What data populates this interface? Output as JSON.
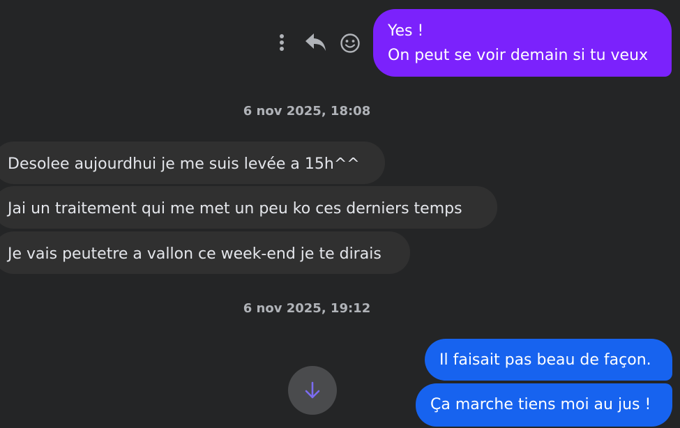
{
  "messages": [
    {
      "direction": "outgoing",
      "lines": [
        "Yes !",
        "On peut se voir demain si tu veux"
      ],
      "color": "#7b22fc"
    },
    {
      "timestamp": "6 nov 2025, 18:08"
    },
    {
      "direction": "incoming",
      "text": "Desolee aujourdhui je me suis levée a 15h^^"
    },
    {
      "direction": "incoming",
      "text": "Jai un traitement qui me met un peu ko ces derniers temps"
    },
    {
      "direction": "incoming",
      "text": "Je vais peutetre a vallon ce week-end je te dirais"
    },
    {
      "timestamp": "6 nov 2025, 19:12"
    },
    {
      "direction": "outgoing",
      "text": "Il faisait pas beau de façon.",
      "color": "#1763ef"
    },
    {
      "direction": "outgoing",
      "text": "Ça marche tiens moi au jus !",
      "color": "#1763ef"
    }
  ],
  "message_actions": {
    "icons": [
      "more-options-icon",
      "reply-icon",
      "emoji-reaction-icon"
    ]
  },
  "scroll_button": {
    "icon": "arrow-down-icon",
    "icon_color": "#7b6cf0"
  },
  "colors": {
    "background": "#242526",
    "incoming_bubble": "#303030",
    "purple_bubble": "#7b22fc",
    "blue_bubble": "#1763ef",
    "timestamp_text": "#b0b3b8"
  }
}
